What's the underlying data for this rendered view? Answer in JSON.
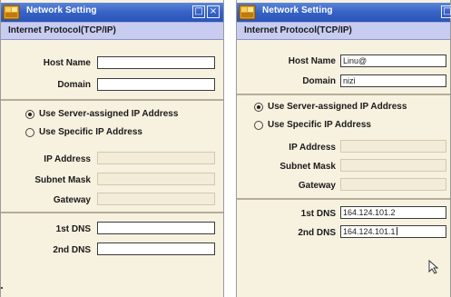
{
  "window_left": {
    "title": "Network Setting",
    "subheader": "Internet Protocol(TCP/IP)",
    "host_name_label": "Host Name",
    "host_name_value": "",
    "domain_label": "Domain",
    "domain_value": "",
    "radio_server_label": "Use Server-assigned IP Address",
    "radio_specific_label": "Use Specific IP Address",
    "ip_label": "IP Address",
    "subnet_label": "Subnet Mask",
    "gateway_label": "Gateway",
    "dns1_label": "1st DNS",
    "dns1_value": "",
    "dns2_label": "2nd DNS",
    "dns2_value": "",
    "selected_radio": "server-assigned"
  },
  "window_right": {
    "title": "Network Setting",
    "subheader": "Internet Protocol(TCP/IP)",
    "host_name_label": "Host Name",
    "host_name_value": "Linu@",
    "domain_label": "Domain",
    "domain_value": "nizi",
    "radio_server_label": "Use Server-assigned IP Address",
    "radio_specific_label": "Use Specific IP Address",
    "ip_label": "IP Address",
    "subnet_label": "Subnet Mask",
    "gateway_label": "Gateway",
    "dns1_label": "1st DNS",
    "dns1_value": "164.124.101.2",
    "dns2_label": "2nd DNS",
    "dns2_value": "164.124.101.1",
    "selected_radio": "server-assigned"
  },
  "icons": {
    "app": "network-app-icon",
    "minimize": "minimize-icon",
    "close": "close-icon",
    "pointer": "mouse-pointer-icon"
  },
  "colors": {
    "title_bar": "#3662c6",
    "subheader": "#c8ccf1",
    "body": "#f7f1df"
  }
}
